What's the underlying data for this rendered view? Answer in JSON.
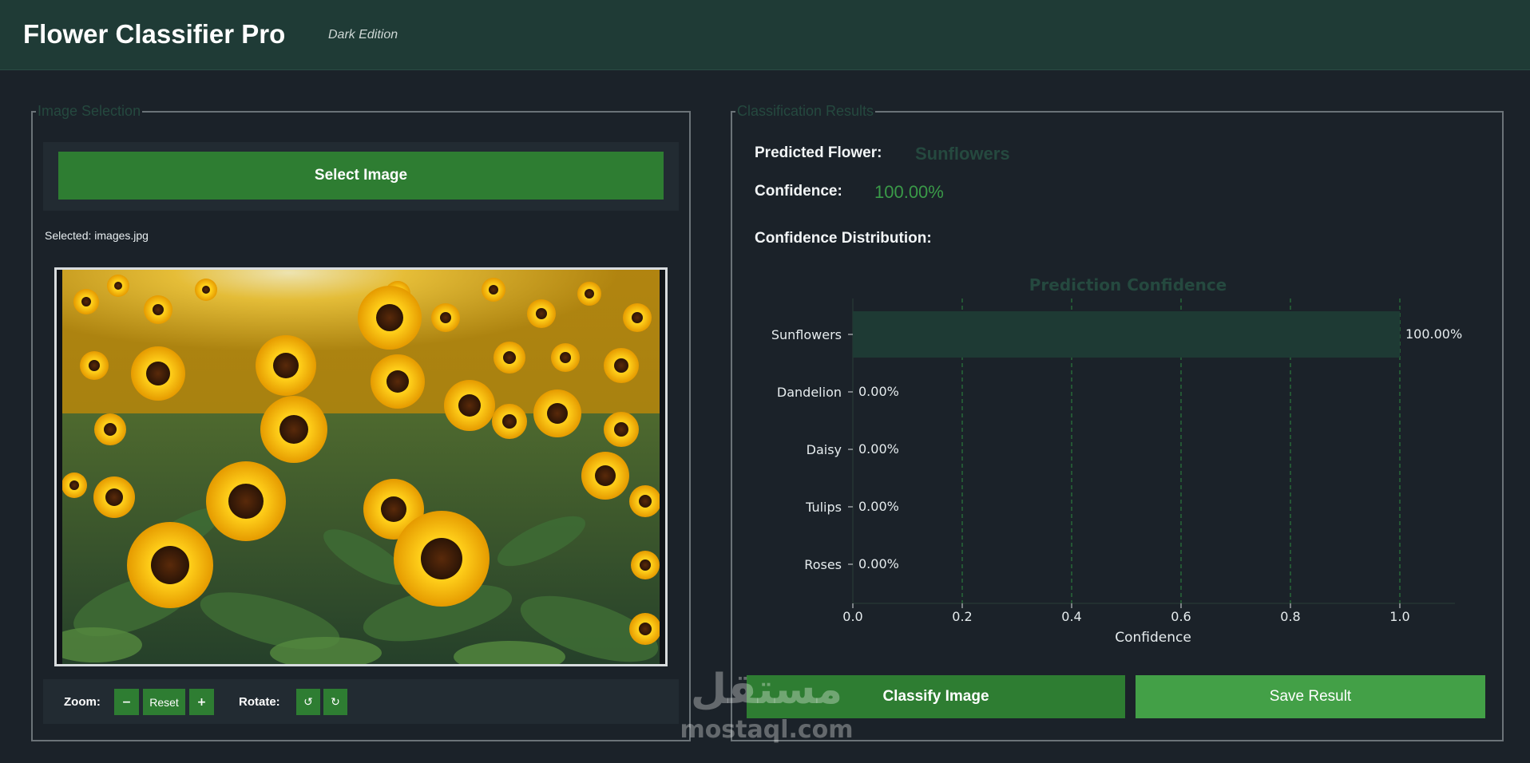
{
  "header": {
    "title": "Flower Classifier Pro",
    "subtitle": "Dark Edition"
  },
  "left_panel": {
    "legend": "Image Selection",
    "select_button": "Select Image",
    "selected_file": "Selected: images.jpg",
    "image_alt": "sunflower field photo",
    "controls": {
      "zoom_label": "Zoom:",
      "zoom_out": "−",
      "zoom_reset": "Reset",
      "zoom_in": "+",
      "rotate_label": "Rotate:",
      "rotate_left_icon": "rotate-left-icon",
      "rotate_right_icon": "rotate-right-icon"
    }
  },
  "right_panel": {
    "legend": "Classification Results",
    "predicted_label": "Predicted Flower:",
    "predicted_value": "Sunflowers",
    "confidence_label": "Confidence:",
    "confidence_value": "100.00%",
    "distribution_label": "Confidence Distribution:",
    "classify_button": "Classify Image",
    "save_button": "Save Result"
  },
  "colors": {
    "header_bg": "#1f3b36",
    "accent_green": "#2e7d32",
    "save_green": "#43a047",
    "confidence_text": "#3a9a48",
    "muted_green_text": "#25493f",
    "bar_fill": "#1e3a34",
    "grid": "#2e8b3e"
  },
  "watermark": {
    "text": "mostaql.com",
    "arabic": "مستقل"
  },
  "chart_data": {
    "type": "bar",
    "orientation": "horizontal",
    "title": "Prediction Confidence",
    "xlabel": "Confidence",
    "ylabel": "",
    "categories": [
      "Sunflowers",
      "Dandelion",
      "Daisy",
      "Tulips",
      "Roses"
    ],
    "values": [
      1.0,
      0.0,
      0.0,
      0.0,
      0.0
    ],
    "value_labels": [
      "100.00%",
      "0.00%",
      "0.00%",
      "0.00%",
      "0.00%"
    ],
    "xlim": [
      0,
      1.1
    ],
    "xticks": [
      "0.0",
      "0.2",
      "0.4",
      "0.6",
      "0.8",
      "1.0"
    ],
    "grid": "x-dashed"
  }
}
